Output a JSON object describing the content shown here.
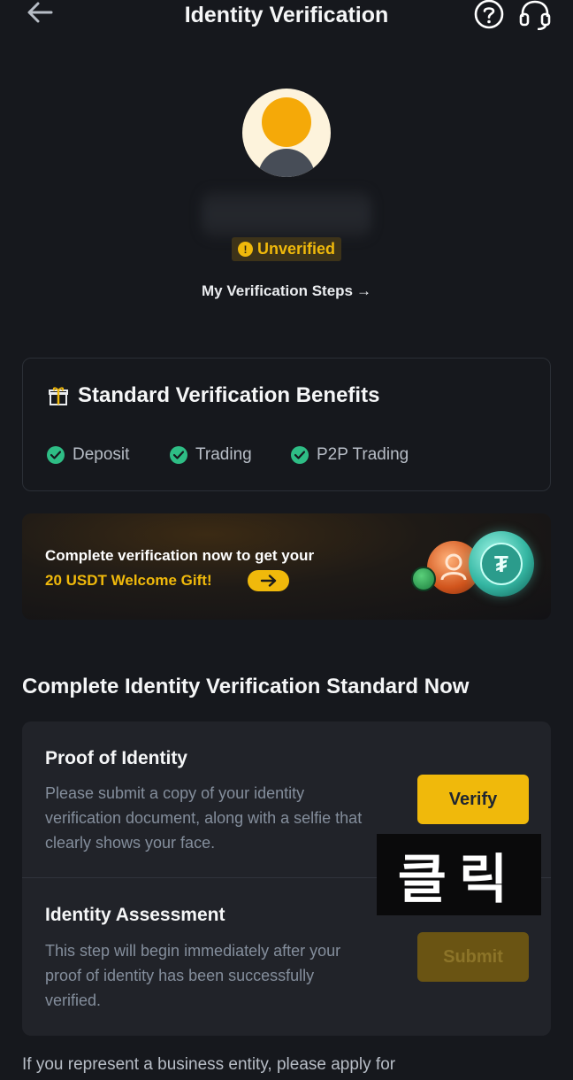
{
  "header": {
    "title": "Identity Verification",
    "back_icon": "arrow-left-icon",
    "help_icon": "question-circle-icon",
    "support_icon": "headset-icon"
  },
  "profile": {
    "status_icon": "exclamation-circle-icon",
    "status": "Unverified",
    "steps_link": "My Verification Steps",
    "steps_link_arrow": "→"
  },
  "benefits": {
    "icon": "gift-icon",
    "title": "Standard Verification Benefits",
    "items": [
      {
        "label": "Deposit"
      },
      {
        "label": "Trading"
      },
      {
        "label": "P2P Trading"
      }
    ]
  },
  "promo": {
    "line1": "Complete verification now to get your",
    "line2": "20 USDT Welcome Gift!",
    "coin_symbol": "₮"
  },
  "section": {
    "title": "Complete Identity Verification Standard Now"
  },
  "steps": [
    {
      "title": "Proof of Identity",
      "desc": "Please submit a copy of your identity verification document, along with a selfie that clearly shows your face.",
      "button": "Verify",
      "enabled": true
    },
    {
      "title": "Identity Assessment",
      "desc": "This step will begin immediately after your proof of identity has been successfully verified.",
      "button": "Submit",
      "enabled": false
    }
  ],
  "overlay": {
    "label": "클릭"
  },
  "footer": {
    "text": "If you represent a business entity, please apply for"
  },
  "colors": {
    "accent": "#f0b90b",
    "success": "#2ebd85",
    "background": "#16181d",
    "card": "#212329"
  }
}
